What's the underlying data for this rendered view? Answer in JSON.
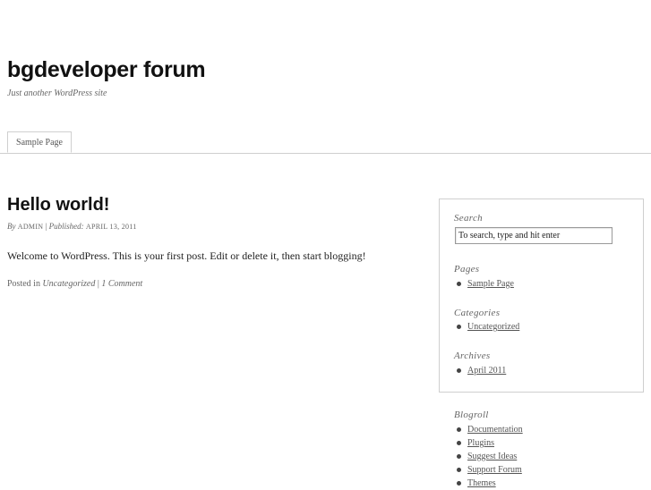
{
  "header": {
    "site_title": "bgdeveloper forum",
    "tagline": "Just another WordPress site"
  },
  "nav": {
    "tabs": [
      {
        "label": "Sample Page"
      }
    ]
  },
  "post": {
    "title": "Hello world!",
    "meta": {
      "by": "By",
      "author": "ADMIN",
      "separator": "|",
      "published_label": "Published:",
      "date": "APRIL 13, 2011"
    },
    "body": "Welcome to WordPress. This is your first post. Edit or delete it, then start blogging!",
    "footer": {
      "posted_in": "Posted in",
      "category": "Uncategorized",
      "separator": "|",
      "comments": "1 Comment"
    }
  },
  "sidebar": {
    "search": {
      "title": "Search",
      "placeholder": "To search, type and hit enter"
    },
    "pages": {
      "title": "Pages",
      "items": [
        "Sample Page"
      ]
    },
    "categories": {
      "title": "Categories",
      "items": [
        "Uncategorized"
      ]
    },
    "archives": {
      "title": "Archives",
      "items": [
        "April 2011"
      ]
    },
    "blogroll": {
      "title": "Blogroll",
      "items": [
        "Documentation",
        "Plugins",
        "Suggest Ideas",
        "Support Forum",
        "Themes"
      ]
    }
  }
}
